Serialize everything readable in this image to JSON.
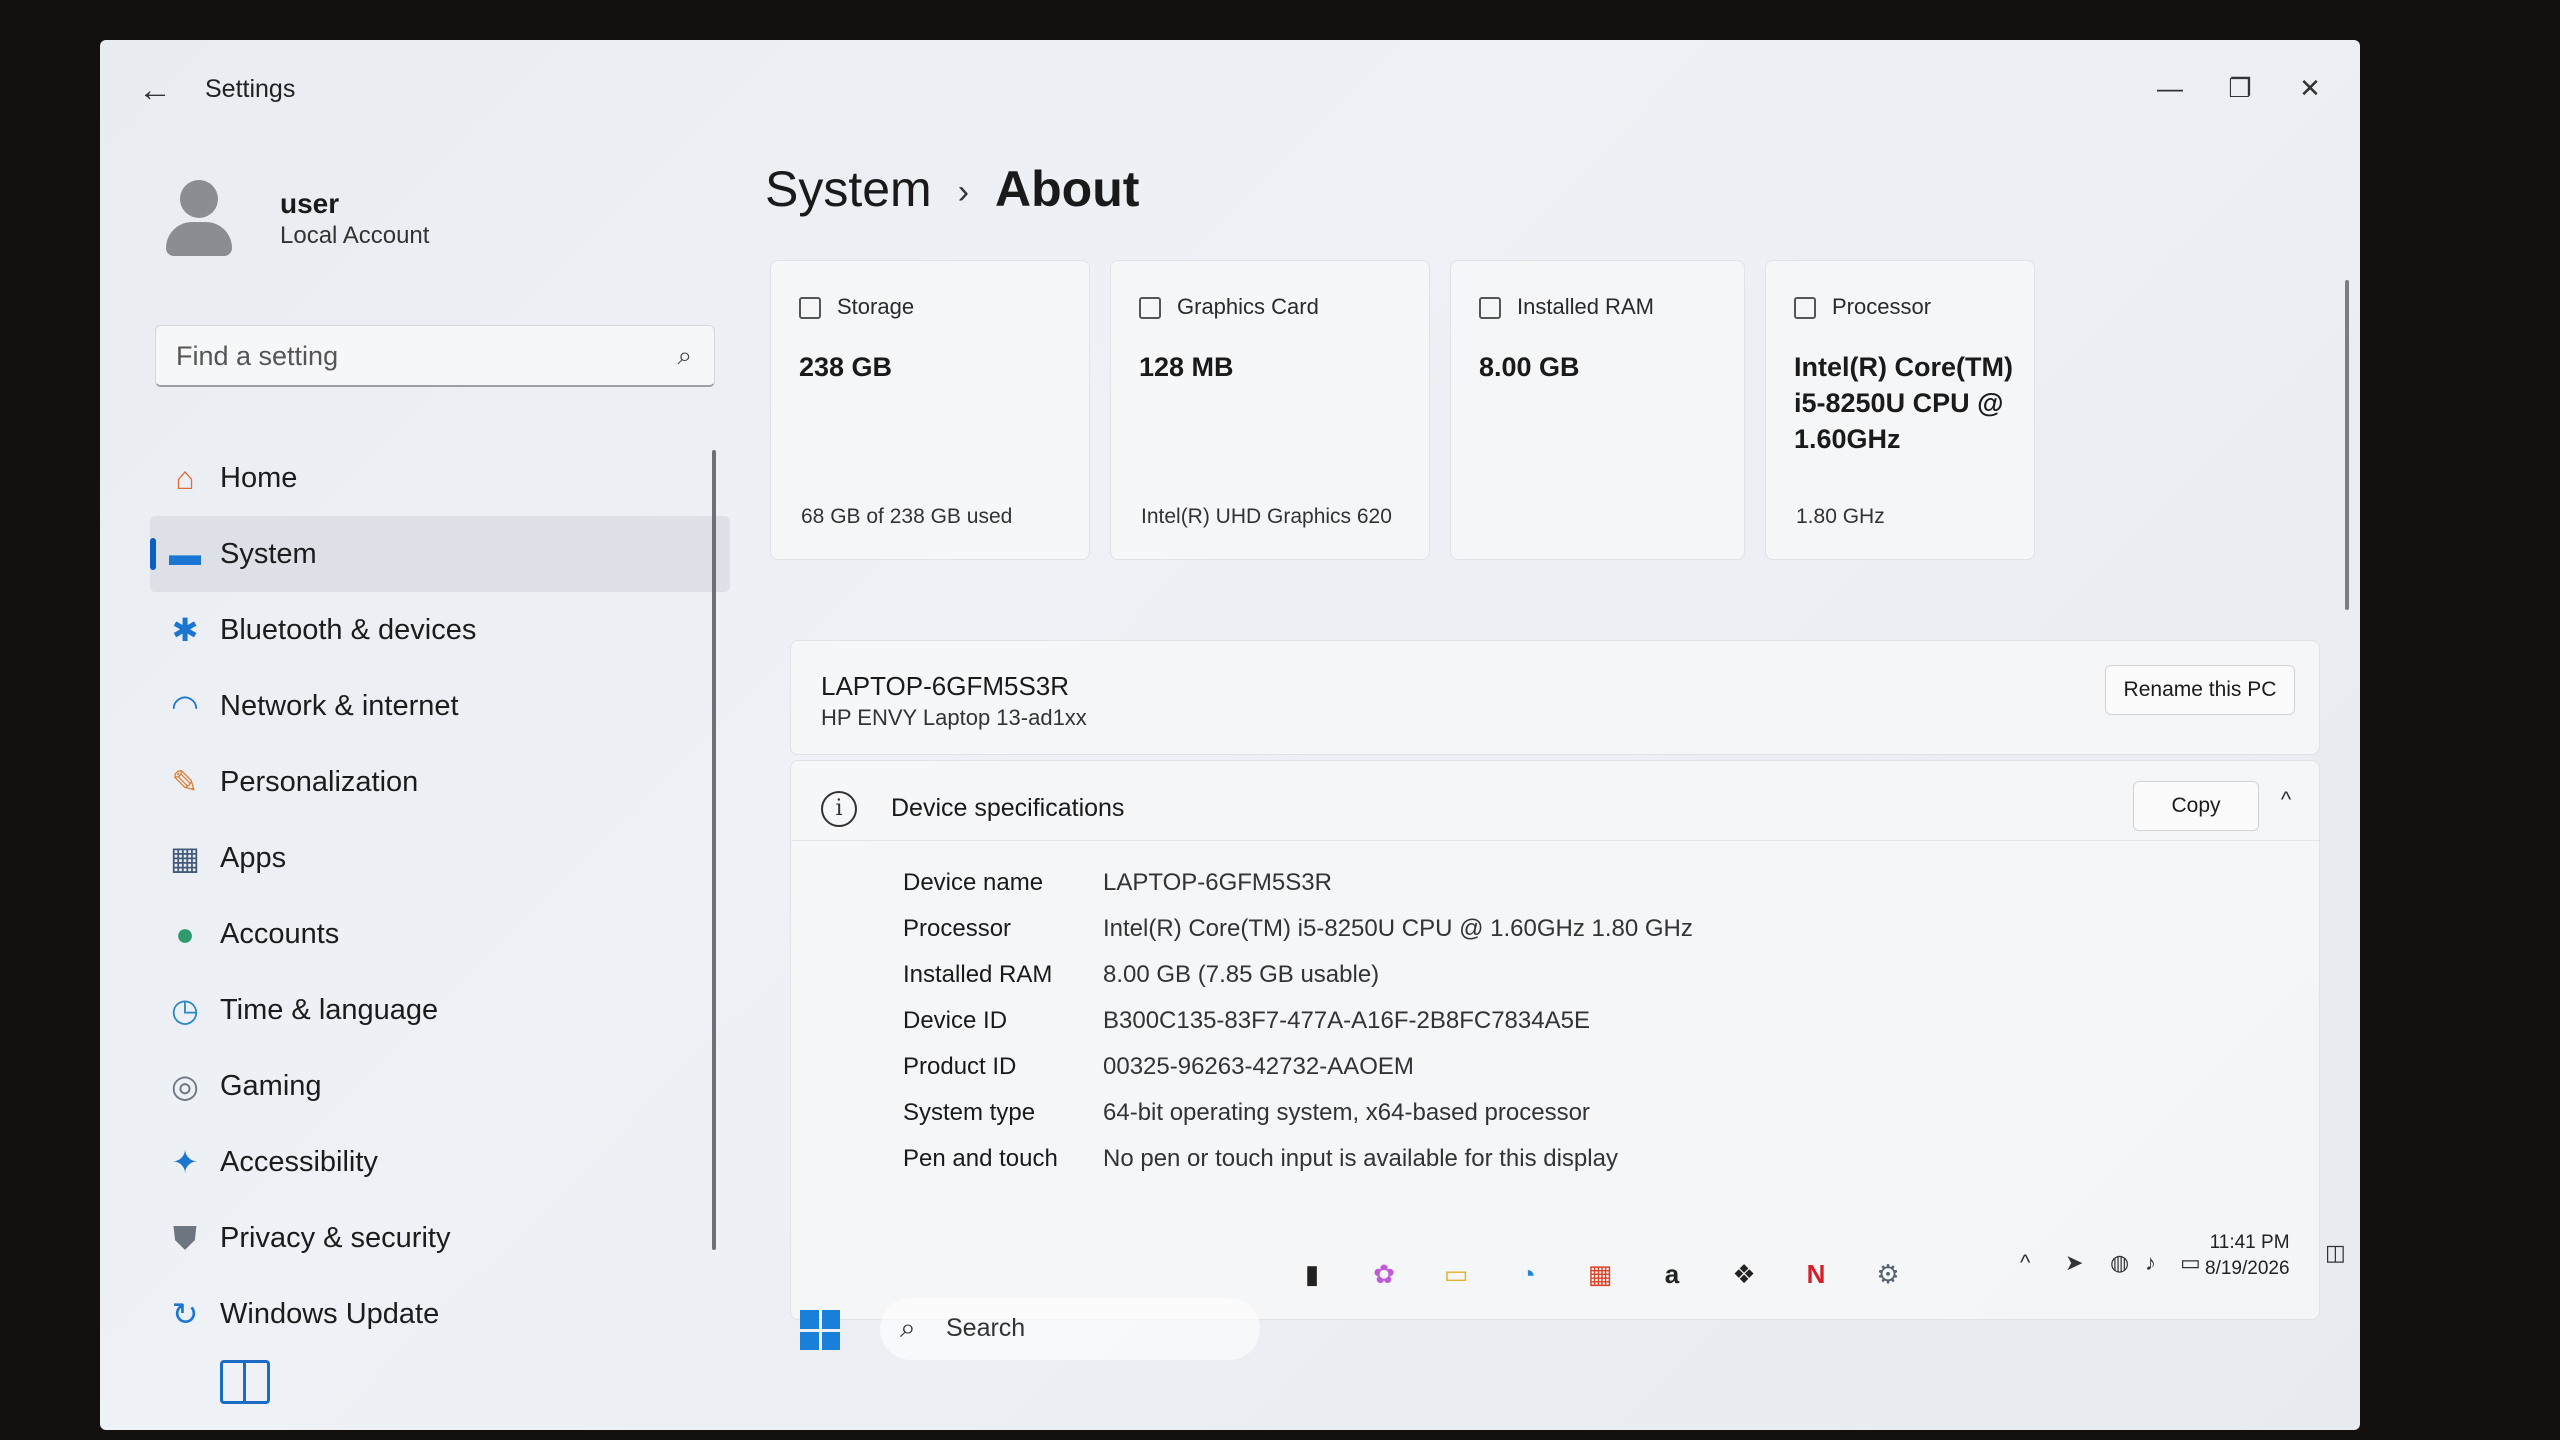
{
  "window": {
    "title": "Settings",
    "back_icon": "arrow-left-icon",
    "minimize": "—",
    "maximize": "❐",
    "close": "✕"
  },
  "profile": {
    "name": "user",
    "type": "Local Account"
  },
  "search": {
    "placeholder": "Find a setting",
    "icon": "⌕"
  },
  "nav": {
    "active": "System",
    "items": [
      {
        "label": "Home",
        "icon": "⌂",
        "color": "#e06b3a"
      },
      {
        "label": "System",
        "icon": "▬",
        "color": "#1b76d2"
      },
      {
        "label": "Bluetooth & devices",
        "icon": "✱",
        "color": "#1b76d2"
      },
      {
        "label": "Network & internet",
        "icon": "◠",
        "color": "#1b76d2"
      },
      {
        "label": "Personalization",
        "icon": "✎",
        "color": "#d9803a"
      },
      {
        "label": "Apps",
        "icon": "▦",
        "color": "#445a7a"
      },
      {
        "label": "Accounts",
        "icon": "●",
        "color": "#2e9a6d"
      },
      {
        "label": "Time & language",
        "icon": "◷",
        "color": "#2a88c4"
      },
      {
        "label": "Gaming",
        "icon": "◎",
        "color": "#6d7580"
      },
      {
        "label": "Accessibility",
        "icon": "✦",
        "color": "#1b76d2"
      },
      {
        "label": "Privacy & security",
        "icon": "⛊",
        "color": "#6d7580"
      },
      {
        "label": "Windows Update",
        "icon": "↻",
        "color": "#1b76d2"
      }
    ]
  },
  "breadcrumb": {
    "parent": "System",
    "separator": "›",
    "current": "About"
  },
  "cards": [
    {
      "title": "Storage",
      "value": "238 GB",
      "sub": "68 GB of 238 GB used"
    },
    {
      "title": "Graphics Card",
      "value": "128 MB",
      "sub": "Intel(R) UHD Graphics 620"
    },
    {
      "title": "Installed RAM",
      "value": "8.00 GB",
      "sub": ""
    },
    {
      "title": "Processor",
      "value": "Intel(R) Core(TM) i5-8250U CPU @ 1.60GHz",
      "sub": "1.80 GHz"
    }
  ],
  "pc": {
    "name": "LAPTOP-6GFM5S3R",
    "model": "HP ENVY Laptop 13-ad1xx",
    "rename_label": "Rename this PC"
  },
  "specs": {
    "title": "Device specifications",
    "copy_label": "Copy",
    "collapse_icon": "^",
    "rows": [
      {
        "key": "Device name",
        "value": "LAPTOP-6GFM5S3R"
      },
      {
        "key": "Processor",
        "value": "Intel(R) Core(TM) i5-8250U CPU @ 1.60GHz   1.80 GHz"
      },
      {
        "key": "Installed RAM",
        "value": "8.00 GB (7.85 GB usable)"
      },
      {
        "key": "Device ID",
        "value": "B300C135-83F7-477A-A16F-2B8FC7834A5E"
      },
      {
        "key": "Product ID",
        "value": "00325-96263-42732-AAOEM"
      },
      {
        "key": "System type",
        "value": "64-bit operating system, x64-based processor"
      },
      {
        "key": "Pen and touch",
        "value": "No pen or touch input is available for this display"
      }
    ]
  },
  "taskbar": {
    "search_label": "Search",
    "apps": [
      {
        "name": "task-view",
        "glyph": "▮",
        "color": "#222222"
      },
      {
        "name": "copilot",
        "glyph": "✿",
        "color": "#c05ad8"
      },
      {
        "name": "file-explorer",
        "glyph": "▭",
        "color": "#e3b12a"
      },
      {
        "name": "edge",
        "glyph": "◔",
        "color": "#1a8ad8"
      },
      {
        "name": "store",
        "glyph": "▦",
        "color": "#d8442a"
      },
      {
        "name": "amazon",
        "glyph": "a",
        "color": "#222222"
      },
      {
        "name": "dropbox",
        "glyph": "❖",
        "color": "#222222"
      },
      {
        "name": "netflix",
        "glyph": "N",
        "color": "#d81f26"
      },
      {
        "name": "settings",
        "glyph": "⚙",
        "color": "#556070"
      }
    ],
    "time": "11:41 PM",
    "date": "8/19/2026"
  }
}
